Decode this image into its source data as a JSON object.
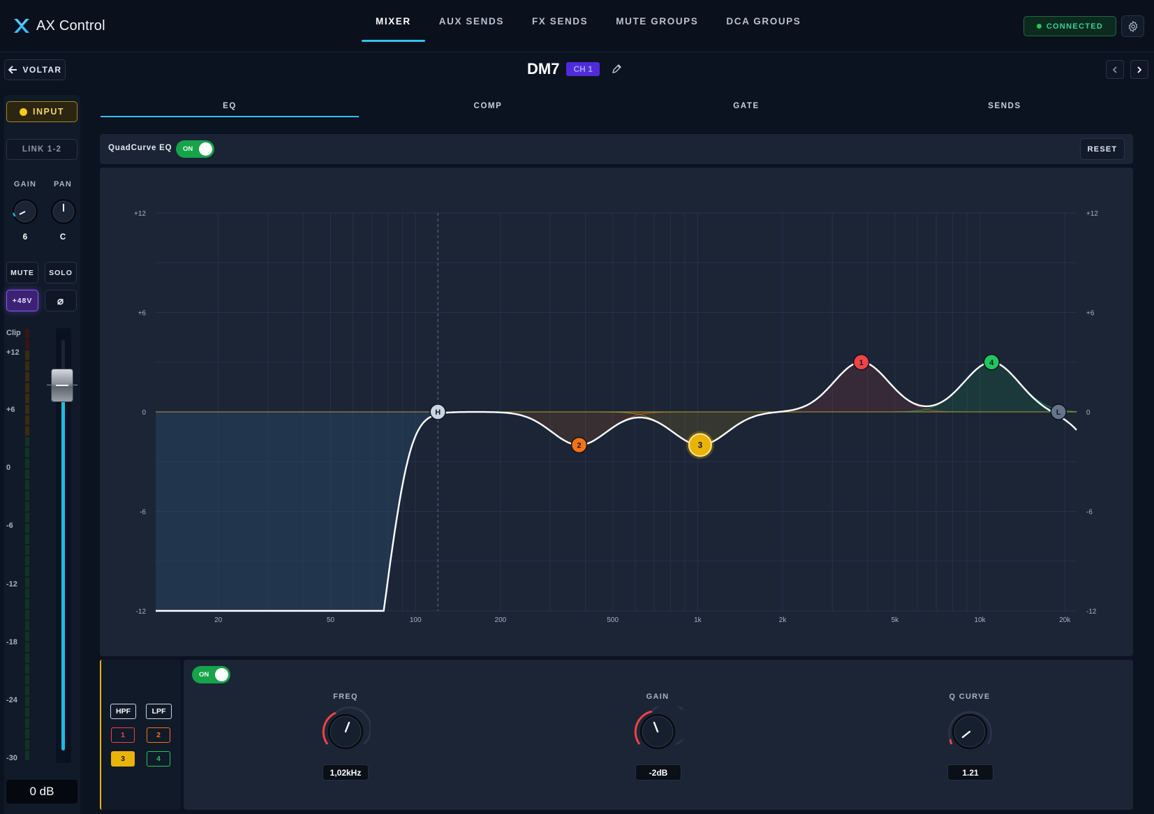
{
  "app": {
    "name": "AX Control"
  },
  "nav": {
    "tabs": [
      {
        "label": "MIXER",
        "active": true
      },
      {
        "label": "AUX SENDS"
      },
      {
        "label": "FX SENDS"
      },
      {
        "label": "MUTE GROUPS"
      },
      {
        "label": "DCA GROUPS"
      }
    ],
    "status": "CONNECTED"
  },
  "header": {
    "back_label": "VOLTAR",
    "channel_name": "DM7",
    "channel_badge": "CH 1"
  },
  "strip": {
    "input_label": "INPUT",
    "link_label": "LINK 1-2",
    "gain_label": "GAIN",
    "gain_value": "6",
    "pan_label": "PAN",
    "pan_value": "C",
    "mute_label": "MUTE",
    "solo_label": "SOLO",
    "phantom_label": "+48V",
    "phase_symbol": "⌀",
    "meter_labels": [
      "Clip",
      "+12",
      "+6",
      "0",
      "-6",
      "-12",
      "-18",
      "-24",
      "-30"
    ],
    "fader_db": "0 dB"
  },
  "tabs": [
    {
      "label": "EQ",
      "active": true
    },
    {
      "label": "COMP"
    },
    {
      "label": "GATE"
    },
    {
      "label": "SENDS"
    }
  ],
  "eq": {
    "name": "QuadCurve EQ",
    "enabled_label": "ON",
    "reset_label": "RESET",
    "y_ticks": [
      "+12",
      "+6",
      "0",
      "-6",
      "-12"
    ],
    "x_ticks": [
      "20",
      "50",
      "100",
      "200",
      "500",
      "1k",
      "2k",
      "5k",
      "10k",
      "20k"
    ],
    "nodes": [
      {
        "label": "H",
        "type": "hpf",
        "freq_hz": 120,
        "gain_db": 0,
        "color": "#cbd5e1"
      },
      {
        "label": "2",
        "type": "bell",
        "freq_hz": 380,
        "gain_db": -2,
        "color": "#f97316"
      },
      {
        "label": "3",
        "type": "bell",
        "freq_hz": 1020,
        "gain_db": -2,
        "color": "#eab308",
        "selected": true
      },
      {
        "label": "1",
        "type": "bell",
        "freq_hz": 3800,
        "gain_db": 3,
        "color": "#ef4444"
      },
      {
        "label": "4",
        "type": "bell",
        "freq_hz": 11000,
        "gain_db": 3,
        "color": "#22c55e"
      },
      {
        "label": "L",
        "type": "lpf",
        "freq_hz": 19000,
        "gain_db": 0,
        "color": "#64748b"
      }
    ]
  },
  "band": {
    "hpf_label": "HPF",
    "lpf_label": "LPF",
    "bands": [
      {
        "label": "1",
        "color": "#ef4444"
      },
      {
        "label": "2",
        "color": "#f97316"
      },
      {
        "label": "3",
        "color": "#eab308",
        "active": true
      },
      {
        "label": "4",
        "color": "#22c55e"
      }
    ],
    "enabled_label": "ON",
    "freq_label": "FREQ",
    "freq_value": "1,02kHz",
    "gain_label": "GAIN",
    "gain_value": "-2dB",
    "q_label": "Q CURVE",
    "q_value": "1.21"
  }
}
